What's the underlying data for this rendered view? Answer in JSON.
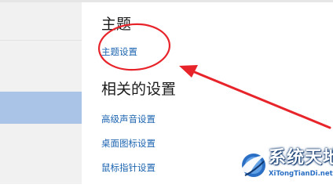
{
  "theme_section": {
    "title": "主题",
    "link": "主题设置"
  },
  "related_section": {
    "title": "相关的设置",
    "links": [
      "高级声音设置",
      "桌面图标设置",
      "鼠标指针设置"
    ]
  },
  "sidebar": {
    "selected_color": "#a9c4e6"
  },
  "annotation": {
    "color": "#e8242b"
  },
  "watermark": {
    "title": "系统天地",
    "url": "XiTongTianDi.net"
  },
  "colors": {
    "link": "#1c64b0",
    "heading": "#1a1a1a"
  }
}
